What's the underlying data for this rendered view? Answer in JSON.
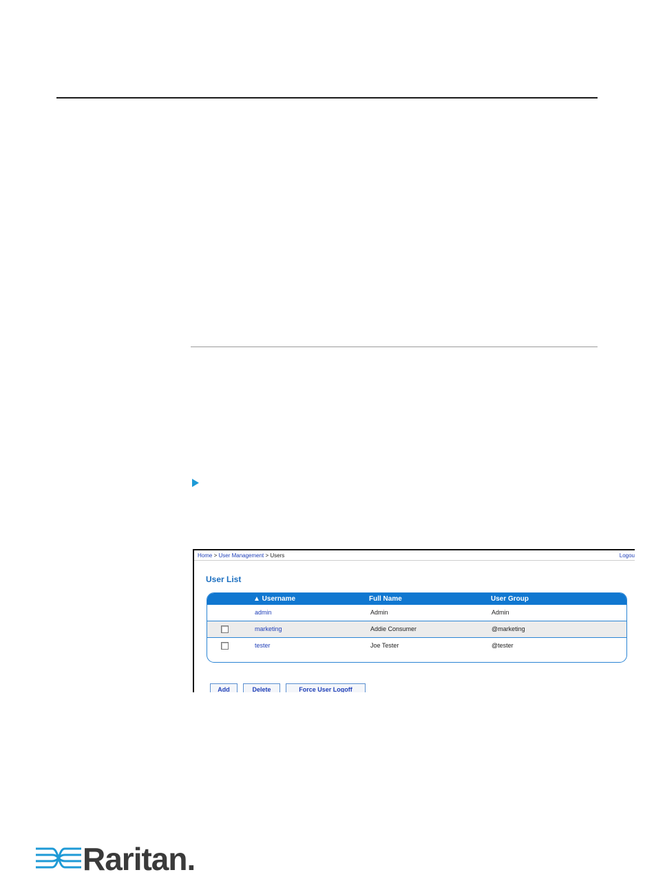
{
  "screenshot": {
    "breadcrumb": {
      "home": "Home",
      "sep1": " > ",
      "user_management": "User Management",
      "sep2": " > ",
      "current": "Users"
    },
    "logout_label": "Logou",
    "title": "User List",
    "table": {
      "columns": {
        "username": "▲ Username",
        "full_name": "Full Name",
        "user_group": "User Group"
      },
      "rows": [
        {
          "username": "admin",
          "full_name": "Admin",
          "user_group": "Admin",
          "checkbox": false
        },
        {
          "username": "marketing",
          "full_name": "Addie Consumer",
          "user_group": "@marketing",
          "checkbox": true
        },
        {
          "username": "tester",
          "full_name": "Joe Tester",
          "user_group": "@tester",
          "checkbox": true
        }
      ]
    },
    "buttons": {
      "add": "Add",
      "delete": "Delete",
      "force_logoff": "Force User Logoff"
    }
  },
  "footer": {
    "logo_text": "Raritan."
  },
  "colors": {
    "accent_blue": "#1077d0",
    "link_blue": "#1f3fb8",
    "bullet_blue": "#1e9ad6"
  }
}
